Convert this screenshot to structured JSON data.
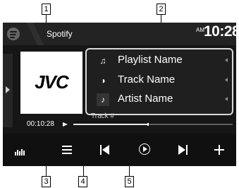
{
  "callouts": {
    "n1": "1",
    "n2": "2",
    "n3": "3",
    "n4": "4",
    "n5": "5"
  },
  "header": {
    "app_title": "Spotify",
    "ampm": "AM",
    "time": "10:28",
    "logo_icon": "spotify-logo-icon",
    "logo_color": "#666666"
  },
  "artwork": {
    "text": "JVC"
  },
  "track_info": {
    "rows": [
      {
        "icon": "music-note-icon",
        "glyph": "♫",
        "text": "Playlist Name"
      },
      {
        "icon": "record-icon",
        "glyph": "◑",
        "text": "Track Name"
      },
      {
        "icon": "artist-icon",
        "glyph": "♪",
        "text": "Artist Name"
      }
    ]
  },
  "playback": {
    "track_label": "Track #",
    "elapsed": "00:10:28",
    "progress_fraction": 0.47,
    "status_icon": "play-status-icon"
  },
  "controls": [
    {
      "name": "equalizer-button",
      "icon": "equalizer-icon"
    },
    {
      "name": "menu-button",
      "icon": "menu-icon"
    },
    {
      "name": "previous-track-button",
      "icon": "previous-track-icon"
    },
    {
      "name": "play-pause-button",
      "icon": "play-pause-icon"
    },
    {
      "name": "next-track-button",
      "icon": "next-track-icon"
    },
    {
      "name": "add-button",
      "icon": "plus-icon"
    }
  ],
  "colors": {
    "screen_background": "#161616",
    "header_background": "#232323",
    "panel_border": "#d8d8d8",
    "text": "#ffffff",
    "progress_fill": "#e8e8e8",
    "progress_track": "#5d5d5d"
  }
}
